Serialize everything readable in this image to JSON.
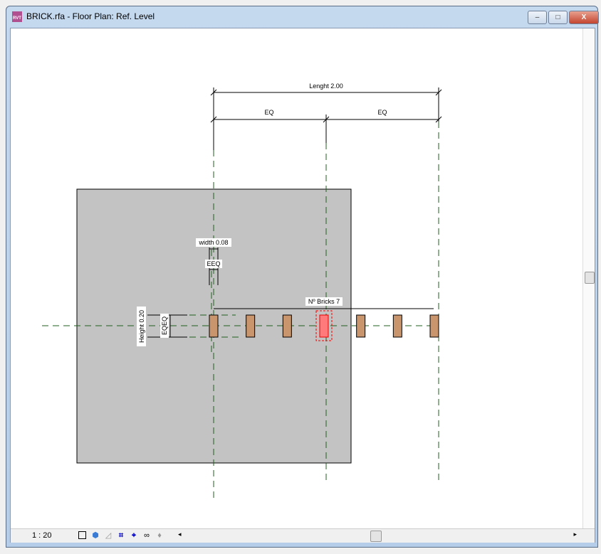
{
  "window": {
    "title": "BRICK.rfa - Floor Plan: Ref. Level",
    "app_icon": "RVT",
    "minimize": "–",
    "maximize": "□",
    "close": "X"
  },
  "drawing": {
    "length_label": "Lenght 2.00",
    "eq_left": "EQ",
    "eq_right": "EQ",
    "width_label": "width  0.08",
    "width_eq": "EEQ",
    "height_label": "Height 0.20",
    "height_eq": "EQEQ",
    "bricks_label": "Nº Bricks 7",
    "brick_count": 7,
    "selected_brick": 3,
    "colors": {
      "brick": "#c8956c",
      "selected": "#ff7a7a",
      "gray_region": "#c3c3c3",
      "ref_lines": "#1f5f1f"
    }
  },
  "statusbar": {
    "scale": "1 : 20"
  }
}
